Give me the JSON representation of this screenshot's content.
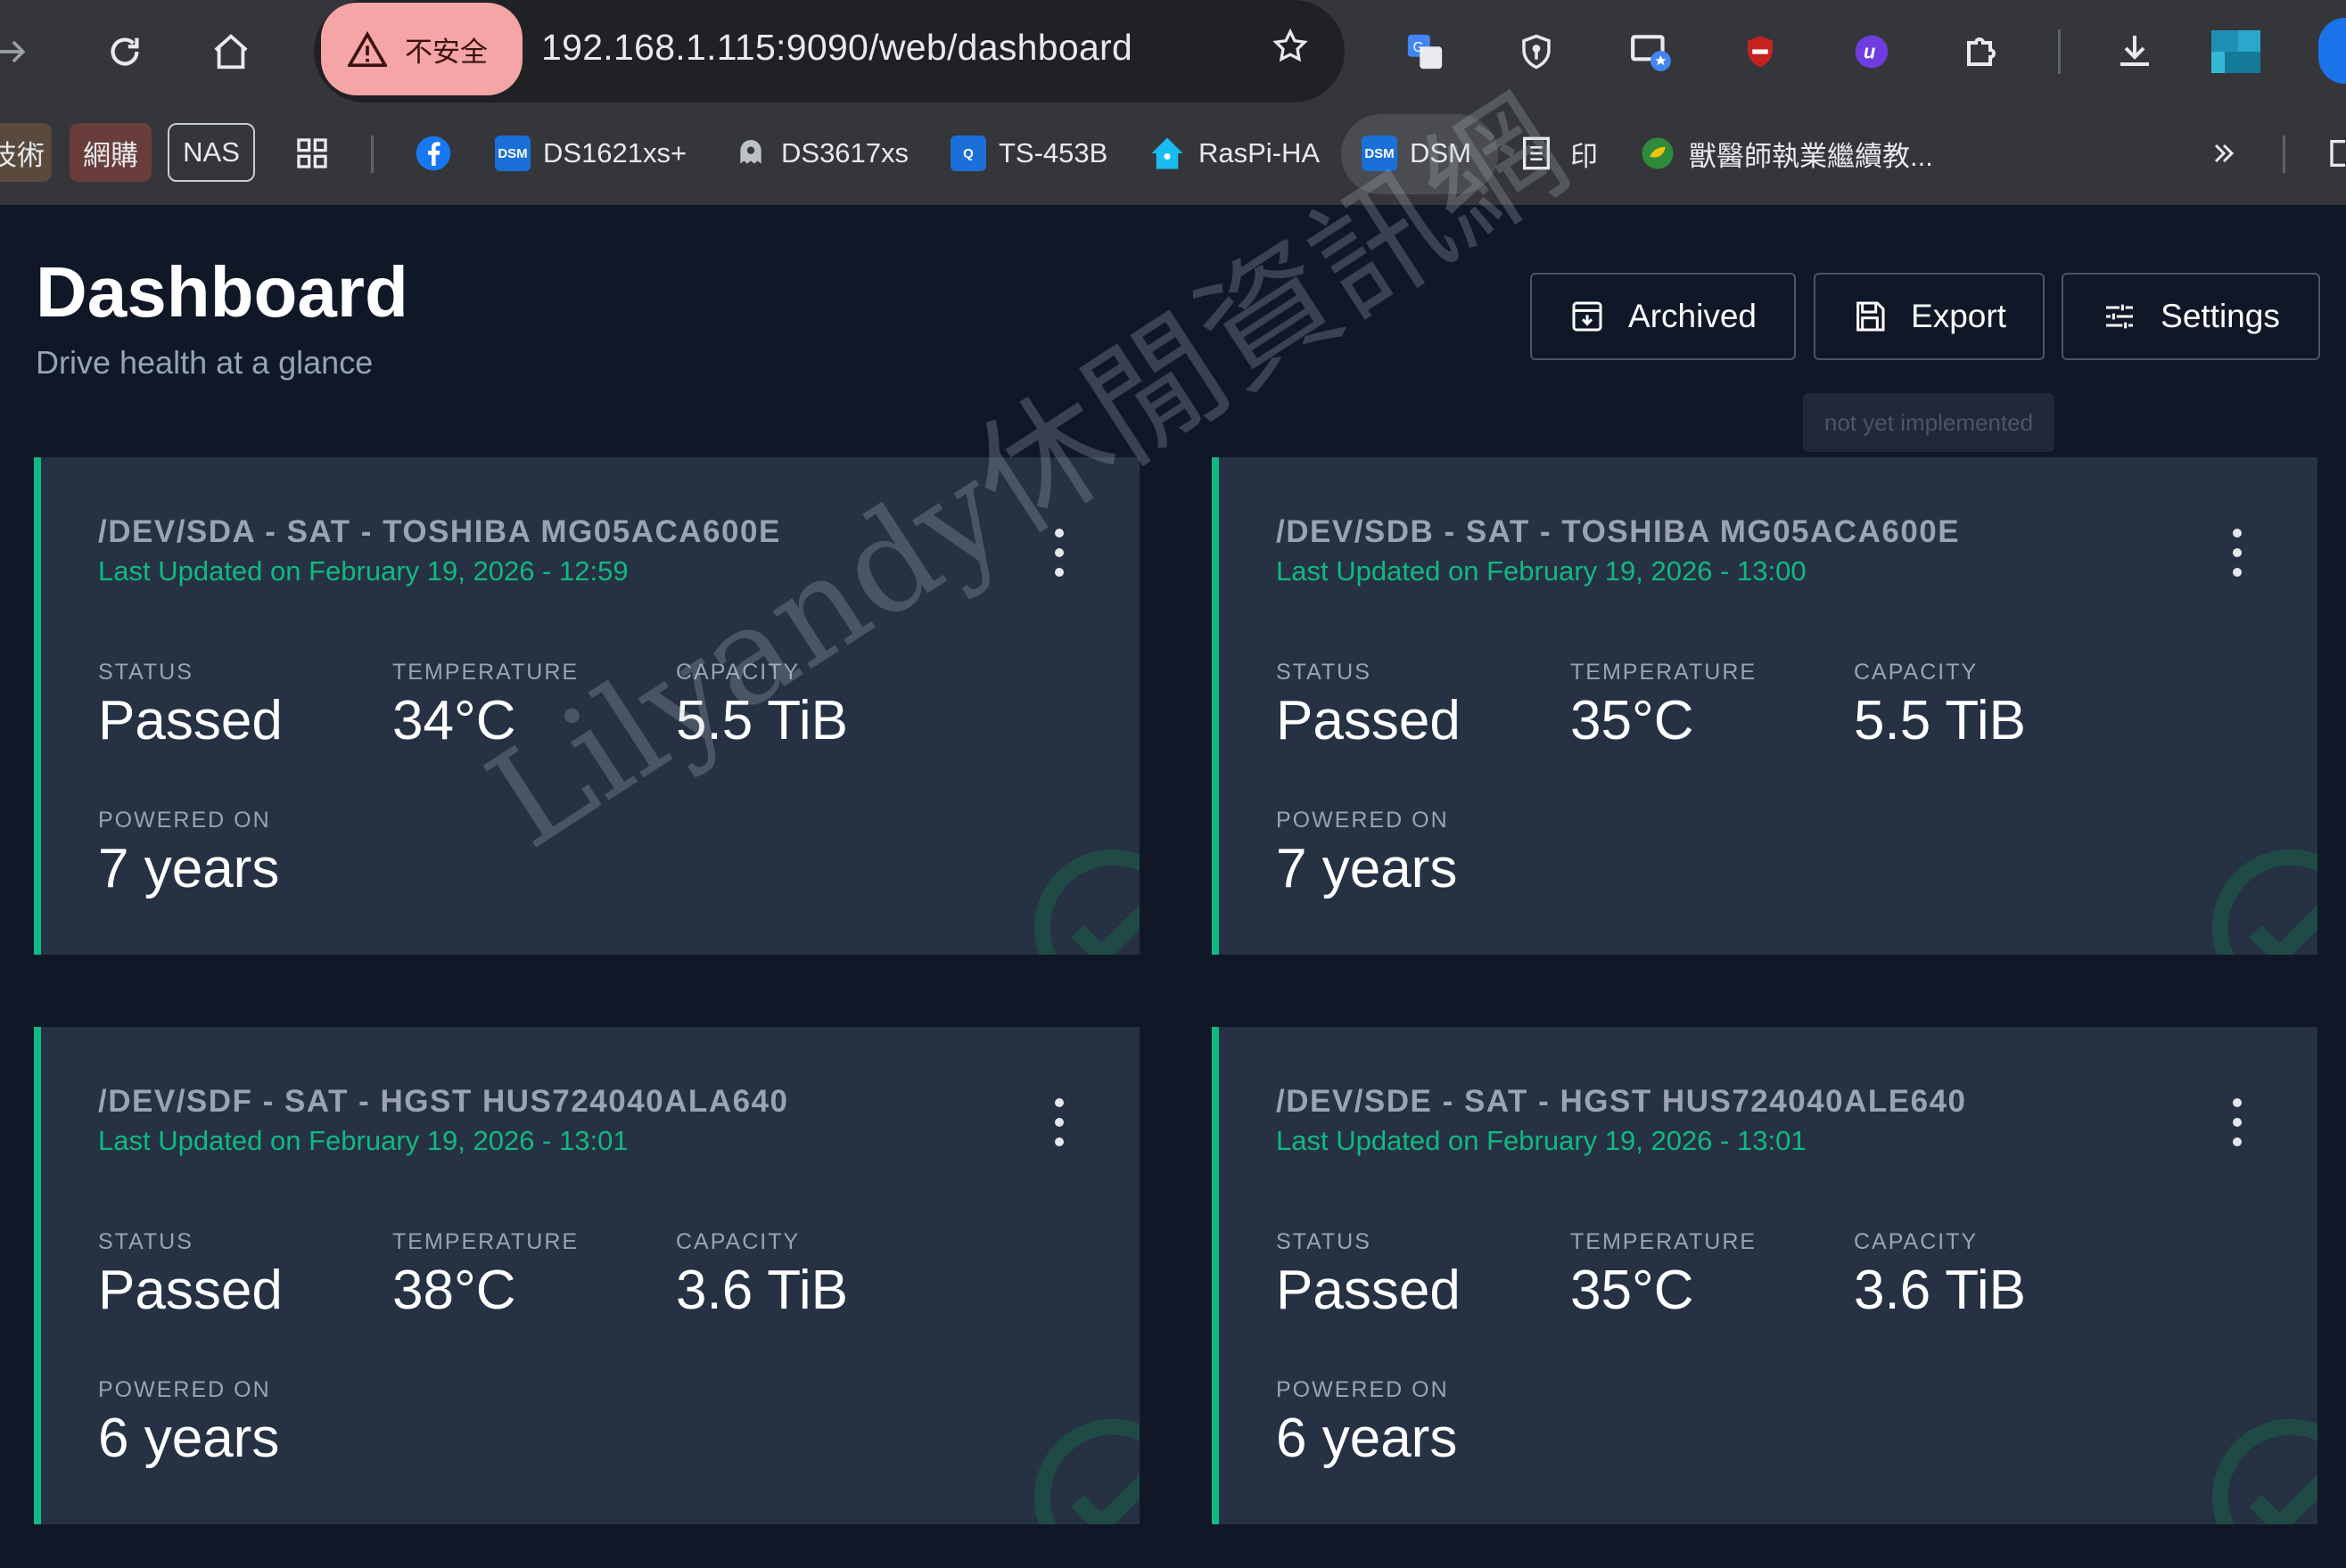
{
  "browser": {
    "security_label": "不安全",
    "url": "192.168.1.115:9090/web/dashboard",
    "bookmarks": {
      "tech": "技術",
      "shop": "網購",
      "nas": "NAS",
      "ds1621": "DS1621xs+",
      "ds3617": "DS3617xs",
      "ts453b": "TS-453B",
      "raspi": "RasPi-HA",
      "dsm": "DSM",
      "print": "印",
      "vet": "獸醫師執業繼續教..."
    }
  },
  "header": {
    "title": "Dashboard",
    "subtitle": "Drive health at a glance",
    "archived": "Archived",
    "export": "Export",
    "settings": "Settings",
    "tooltip": "not yet implemented"
  },
  "labels": {
    "status": "STATUS",
    "temperature": "TEMPERATURE",
    "capacity": "CAPACITY",
    "powered_on": "POWERED ON"
  },
  "drives": [
    {
      "title": "/DEV/SDA - SAT - TOSHIBA MG05ACA600E",
      "updated": "Last Updated on February 19, 2026 - 12:59",
      "status": "Passed",
      "temperature": "34°C",
      "capacity": "5.5 TiB",
      "powered_on": "7 years"
    },
    {
      "title": "/DEV/SDB - SAT - TOSHIBA MG05ACA600E",
      "updated": "Last Updated on February 19, 2026 - 13:00",
      "status": "Passed",
      "temperature": "35°C",
      "capacity": "5.5 TiB",
      "powered_on": "7 years"
    },
    {
      "title": "/DEV/SDF - SAT - HGST HUS724040ALA640",
      "updated": "Last Updated on February 19, 2026 - 13:01",
      "status": "Passed",
      "temperature": "38°C",
      "capacity": "3.6 TiB",
      "powered_on": "6 years"
    },
    {
      "title": "/DEV/SDE - SAT - HGST HUS724040ALE640",
      "updated": "Last Updated on February 19, 2026 - 13:01",
      "status": "Passed",
      "temperature": "35°C",
      "capacity": "3.6 TiB",
      "powered_on": "6 years"
    }
  ],
  "watermark": "Lilyandy休閒資訊網",
  "colors": {
    "accent": "#10b981",
    "background": "#101828",
    "card": "#263143"
  }
}
